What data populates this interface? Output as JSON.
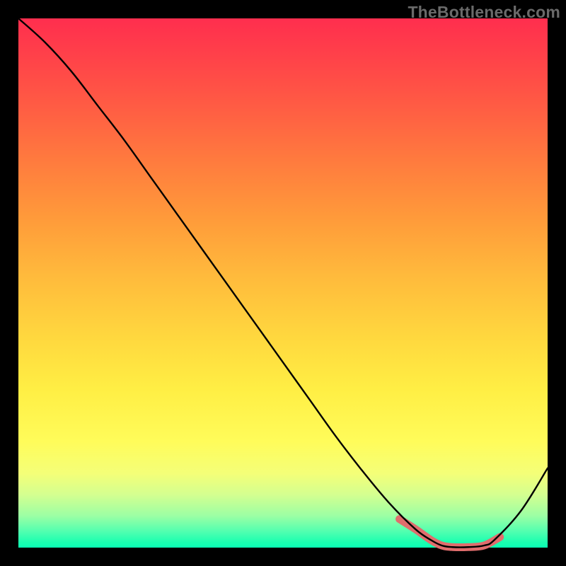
{
  "watermark": "TheBottleneck.com",
  "colors": {
    "curve": "#000000",
    "highlight": "#e06d6d",
    "background_frame": "#000000"
  },
  "chart_data": {
    "type": "line",
    "title": "",
    "xlabel": "",
    "ylabel": "",
    "xlim": [
      0,
      100
    ],
    "ylim": [
      0,
      100
    ],
    "series": [
      {
        "name": "curve",
        "x": [
          0,
          5,
          10,
          15,
          20,
          25,
          30,
          35,
          40,
          45,
          50,
          55,
          60,
          65,
          70,
          75,
          78,
          80,
          82,
          85,
          88,
          90,
          95,
          100
        ],
        "y": [
          100,
          95.5,
          90,
          83.5,
          77,
          70,
          63,
          56,
          49,
          42,
          35,
          28,
          21,
          14.5,
          8.5,
          3.5,
          1.4,
          0.4,
          0.1,
          0.1,
          0.4,
          1.5,
          7,
          15
        ]
      },
      {
        "name": "highlight",
        "x": [
          72,
          75,
          78,
          80,
          82,
          85,
          88,
          91
        ],
        "y": [
          5.4,
          3.5,
          1.4,
          0.4,
          0.1,
          0.1,
          0.4,
          2.0
        ]
      }
    ]
  }
}
